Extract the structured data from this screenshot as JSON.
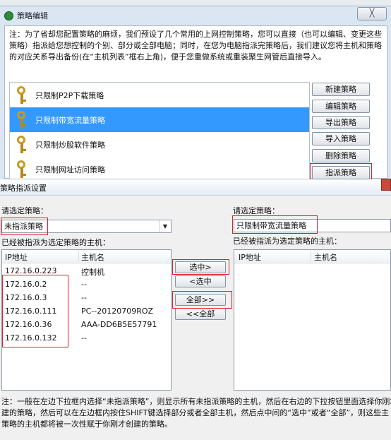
{
  "dialog1": {
    "title": "策略编辑",
    "close_label": "╳",
    "note": "注：为了省却您配置策略的麻烦，我们预设了几个常用的上网控制策略，您可以直接（也可以编辑、变更这些策略）指派给您想控制的个别、部分或全部电脑；同时，在您为电脑指派完策略后，我们建议您将主机和策略的对应关系导出备份(在“主机列表”框右上角)，便于您重做系统或重装聚生网管后直接导入。",
    "policies": [
      {
        "label": "只限制P2P下载策略",
        "selected": false
      },
      {
        "label": "只限制带宽流量策略",
        "selected": true
      },
      {
        "label": "只限制炒股软件策略",
        "selected": false
      },
      {
        "label": "只限制网址访问策略",
        "selected": false
      }
    ],
    "buttons": {
      "new": "新建策略",
      "edit": "编辑策略",
      "export": "导出策略",
      "import": "导入策略",
      "delete": "删除策略",
      "assign": "指派策略"
    }
  },
  "dialog2": {
    "title": "策略指派设置",
    "left": {
      "select_label": "请选定策略：",
      "combo_value": "未指派策略",
      "list_label": "已经被指派为选定策略的主机：",
      "col_ip": "IP地址",
      "col_host": "主机名",
      "rows": [
        {
          "ip": "172.16.0.223",
          "host": "控制机"
        },
        {
          "ip": "172.16.0.2",
          "host": "--"
        },
        {
          "ip": "172.16.0.3",
          "host": "--"
        },
        {
          "ip": "172.16.0.111",
          "host": "PC--20120709ROZ"
        },
        {
          "ip": "172.16.0.36",
          "host": "AAA-DD6B5E57791"
        },
        {
          "ip": "172.16.0.132",
          "host": "--"
        }
      ]
    },
    "middle": {
      "select_right": "选中>",
      "select_left": "<选中",
      "all_right": "全部>>",
      "all_left": "<<全部"
    },
    "right": {
      "select_label": "请选定策略：",
      "combo_value": "只限制带宽流量策略",
      "list_label": "已经被指派为选定策略的主机：",
      "col_ip": "IP地址",
      "col_host": "主机名"
    },
    "note_lines": [
      "注：一般在左边下拉框内选择“未指派策略”，则显示所有未指派策略的主机，然后在右边的下拉按钮里面选择你刚才",
      "建的策略，然后可以在左边框内按住SHIFT键选择部分或者全部主机，然后点中间的“选中”或者“全部”，则这些主",
      "策略的主机都将被一次性赋于你刚才创建的策略。"
    ]
  }
}
